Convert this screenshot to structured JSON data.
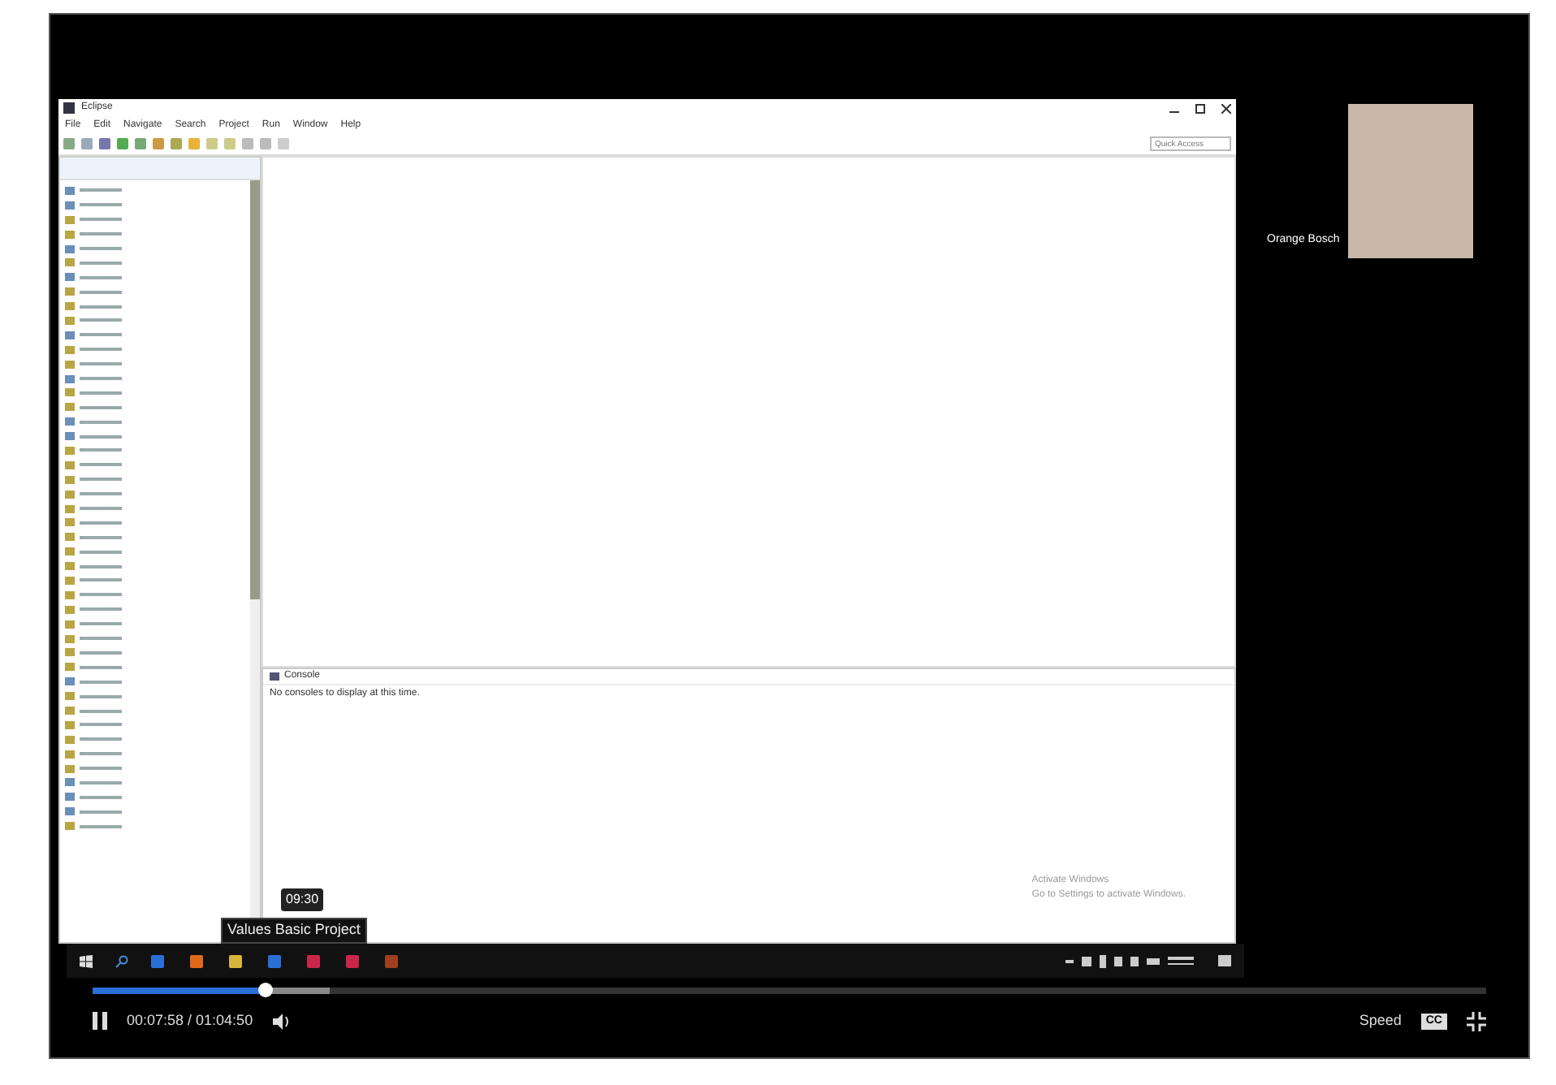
{
  "eclipse": {
    "title": "Eclipse",
    "menu": [
      "File",
      "Edit",
      "Navigate",
      "Search",
      "Project",
      "Run",
      "Window",
      "Help"
    ],
    "quick_access": {
      "placeholder": "Quick Access"
    },
    "explorer_items": [
      {
        "kind": "folder"
      },
      {
        "kind": "folder"
      },
      {
        "kind": "project"
      },
      {
        "kind": "project"
      },
      {
        "kind": "folder"
      },
      {
        "kind": "project"
      },
      {
        "kind": "folder"
      },
      {
        "kind": "project"
      },
      {
        "kind": "project"
      },
      {
        "kind": "project"
      },
      {
        "kind": "folder"
      },
      {
        "kind": "project"
      },
      {
        "kind": "project"
      },
      {
        "kind": "folder"
      },
      {
        "kind": "project"
      },
      {
        "kind": "project"
      },
      {
        "kind": "folder"
      },
      {
        "kind": "folder"
      },
      {
        "kind": "project"
      },
      {
        "kind": "project"
      },
      {
        "kind": "project"
      },
      {
        "kind": "project"
      },
      {
        "kind": "project"
      },
      {
        "kind": "project"
      },
      {
        "kind": "project"
      },
      {
        "kind": "project"
      },
      {
        "kind": "project"
      },
      {
        "kind": "project"
      },
      {
        "kind": "project"
      },
      {
        "kind": "project"
      },
      {
        "kind": "project"
      },
      {
        "kind": "project"
      },
      {
        "kind": "project"
      },
      {
        "kind": "project"
      },
      {
        "kind": "folder"
      },
      {
        "kind": "project"
      },
      {
        "kind": "project"
      },
      {
        "kind": "project"
      },
      {
        "kind": "project"
      },
      {
        "kind": "project"
      },
      {
        "kind": "project"
      },
      {
        "kind": "folder"
      },
      {
        "kind": "folder"
      },
      {
        "kind": "folder"
      },
      {
        "kind": "project"
      }
    ],
    "console": {
      "tab": "Console",
      "message": "No consoles to display at this time."
    },
    "activation": [
      "Activate Windows",
      "Go to Settings to activate Windows."
    ]
  },
  "taskbar": {
    "tooltip": "Values Basic Project",
    "apps": [
      {
        "color": "#2a6fd6"
      },
      {
        "color": "#e06a1c"
      },
      {
        "color": "#d9b43a"
      },
      {
        "color": "#2a6fd6"
      },
      {
        "color": "#c8264a"
      },
      {
        "color": "#c8264a"
      },
      {
        "color": "#a04020"
      }
    ]
  },
  "participant": {
    "name": "Orange Bosch"
  },
  "player": {
    "hover_time": "09:30",
    "progress": {
      "level": 0.124
    },
    "buffer": {
      "level": 0.17
    },
    "playing": true,
    "time": "00:07:58 / 01:04:50",
    "speed": "Speed",
    "cc": "CC"
  }
}
